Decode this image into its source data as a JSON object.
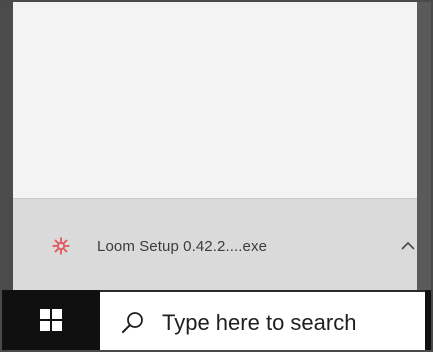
{
  "downloads": {
    "items": [
      {
        "file_name": "Loom Setup 0.42.2....exe",
        "icon": "loom-icon"
      }
    ],
    "expand_icon": "chevron-up-icon"
  },
  "taskbar": {
    "start_icon": "windows-logo-icon",
    "search": {
      "placeholder": "Type here to search",
      "icon": "search-icon"
    }
  },
  "colors": {
    "download_bar_bg": "#dadada",
    "loom_accent": "#e0565b",
    "taskbar_bg": "#101010"
  }
}
